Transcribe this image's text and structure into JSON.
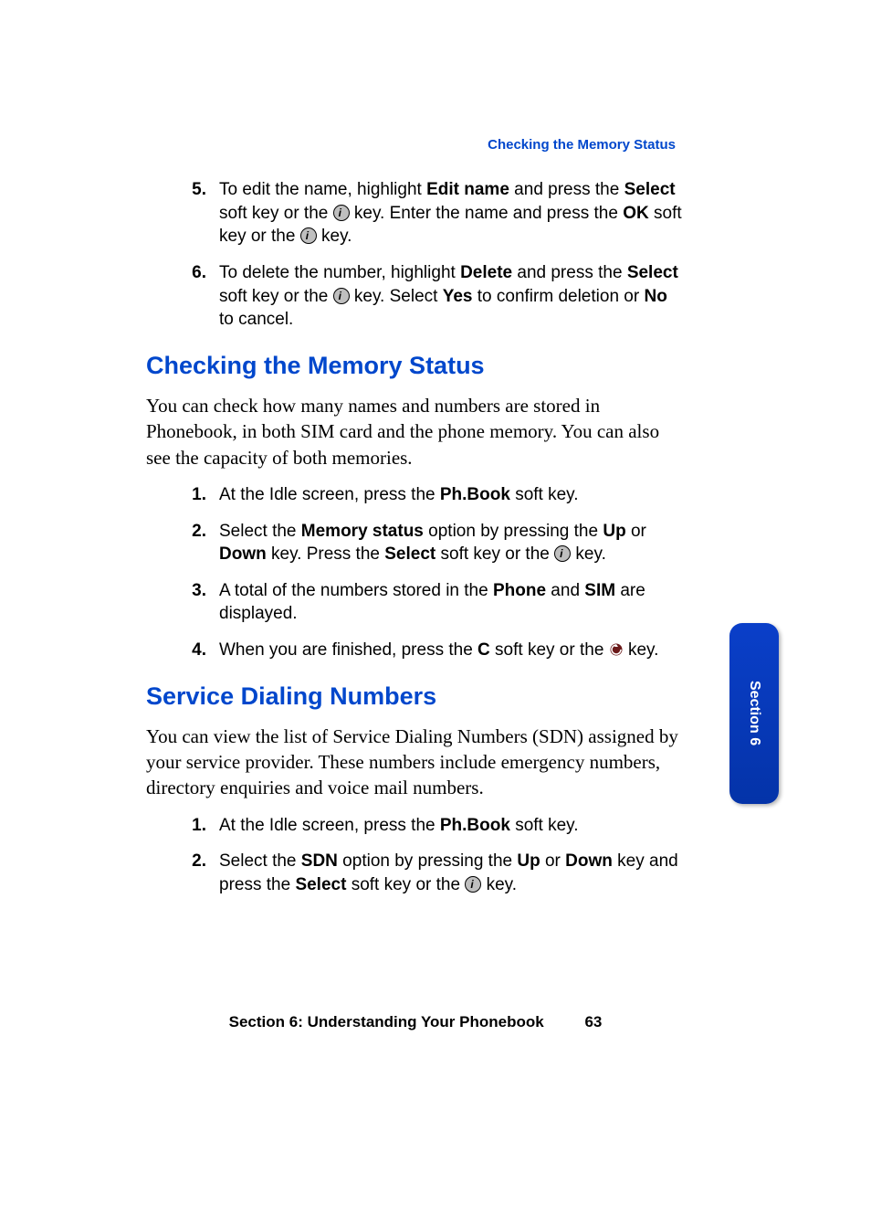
{
  "running_head": "Checking the Memory Status",
  "top_list": {
    "5": {
      "num": "5.",
      "pre": "To edit the name, highlight ",
      "b1": "Edit name",
      "mid1": " and press the ",
      "b2": "Select",
      "mid2": " soft key or the ",
      "mid3": " key. Enter the name and press the ",
      "b3": "OK",
      "mid4": " soft key or the ",
      "tail": " key."
    },
    "6": {
      "num": "6.",
      "pre": "To delete the number, highlight ",
      "b1": "Delete",
      "mid1": " and press the ",
      "b2": "Select",
      "mid2": " soft key or the ",
      "mid3": " key. Select ",
      "b3": "Yes",
      "mid4": " to confirm deletion or ",
      "b4": "No",
      "tail": " to cancel."
    }
  },
  "h2a": "Checking the Memory Status",
  "para_a": "You can check how many names and numbers are stored in Phonebook, in both SIM card and the phone memory. You can also see the capacity of both memories.",
  "list_a": {
    "1": {
      "num": "1.",
      "pre": "At the Idle screen, press the ",
      "b1": "Ph.Book",
      "tail": " soft key."
    },
    "2": {
      "num": "2.",
      "pre": "Select the ",
      "b1": "Memory status",
      "mid1": " option by pressing the ",
      "b2": "Up",
      "mid2": " or ",
      "b3": "Down",
      "mid3": " key. Press the ",
      "b4": "Select",
      "mid4": " soft key or the ",
      "tail": " key."
    },
    "3": {
      "num": "3.",
      "pre": "A total of the numbers stored in the ",
      "b1": "Phone",
      "mid1": " and ",
      "b2": "SIM",
      "tail": " are displayed."
    },
    "4": {
      "num": "4.",
      "pre": "When you are finished, press the ",
      "b1": "C",
      "mid1": " soft key or the ",
      "tail": " key."
    }
  },
  "h2b": "Service Dialing Numbers",
  "para_b": "You can view the list of Service Dialing Numbers (SDN) assigned by your service provider. These numbers include emergency numbers, directory enquiries and voice mail numbers.",
  "list_b": {
    "1": {
      "num": "1.",
      "pre": "At the Idle screen, press the ",
      "b1": "Ph.Book",
      "tail": " soft key."
    },
    "2": {
      "num": "2.",
      "pre": "Select the ",
      "b1": "SDN",
      "mid1": " option by pressing the ",
      "b2": "Up",
      "mid2": " or ",
      "b3": "Down",
      "mid3": " key and press the ",
      "b4": "Select",
      "mid4": " soft key or the ",
      "tail": " key."
    }
  },
  "tab_label": "Section 6",
  "footer_text": "Section 6: Understanding Your Phonebook",
  "page_number": "63"
}
